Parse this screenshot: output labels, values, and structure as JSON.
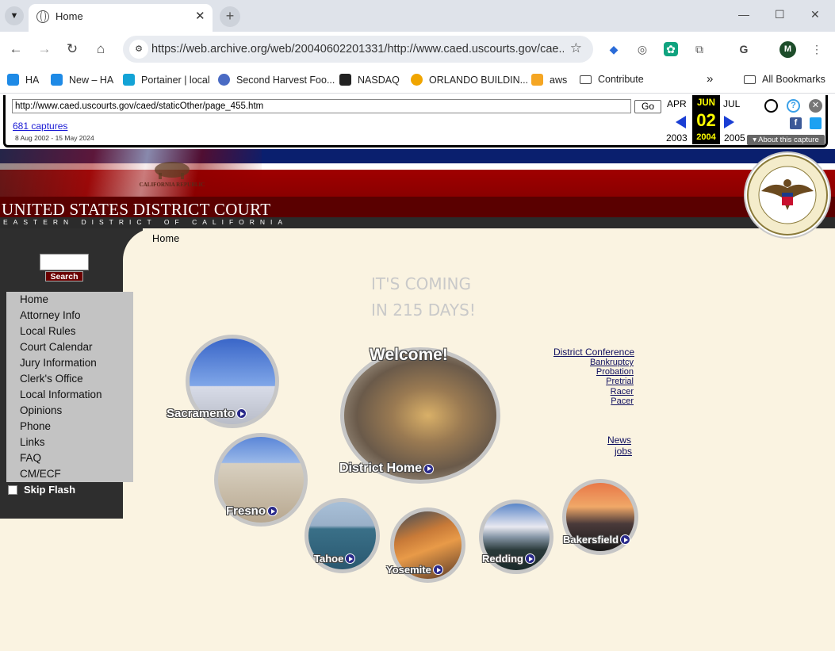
{
  "browser": {
    "tab_title": "Home",
    "url": "https://web.archive.org/web/20040602201331/http://www.caed.uscourts.gov/cae...",
    "bookmarks": [
      {
        "label": "HA",
        "color": "#1e8ae6"
      },
      {
        "label": "New – HA",
        "color": "#1e8ae6"
      },
      {
        "label": "Portainer | local",
        "color": "#13a3d6"
      },
      {
        "label": "Second Harvest Foo...",
        "color": "#4a6bc4"
      },
      {
        "label": "NASDAQ",
        "color": "#222222"
      },
      {
        "label": "ORLANDO BUILDIN...",
        "color": "#f0a500"
      },
      {
        "label": "aws",
        "color": "#f5a623"
      },
      {
        "label": "Contribute",
        "color": "folder"
      }
    ],
    "all_bookmarks": "All Bookmarks",
    "overflow": "»",
    "profile_initial": "M"
  },
  "wayback": {
    "url": "http://www.caed.uscourts.gov/caed/staticOther/page_455.htm",
    "go": "Go",
    "captures": "681 captures",
    "range": "8 Aug 2002 - 15 May 2024",
    "prev_month": "APR",
    "cur_month": "JUN",
    "next_month": "JUL",
    "cur_day": "02",
    "prev_year": "2003",
    "cur_year": "2004",
    "next_year": "2005",
    "about": "▾ About this capture"
  },
  "court": {
    "title": "UNITED STATES DISTRICT COURT",
    "subtitle": "EASTERN DISTRICT OF CALIFORNIA",
    "flag_text": "CALIFORNIA REPUBLIC",
    "seal_text": "UNITED STATES DISTRICT COURT · Eastern District of California"
  },
  "page": {
    "breadcrumb": "Home",
    "search_button": "Search",
    "nav": [
      "Home",
      "Attorney Info",
      "Local Rules",
      "Court Calendar",
      "Jury Information",
      "Clerk's Office",
      "Local Information",
      "Opinions",
      "Phone",
      "Links",
      "FAQ",
      "CM/ECF"
    ],
    "skip_flash": "Skip Flash",
    "countdown_line1": "IT'S COMING",
    "countdown_line2": "IN 215 DAYS!",
    "welcome": "Welcome!",
    "circles": {
      "sacramento": "Sacramento",
      "district_home": "District Home",
      "fresno": "Fresno",
      "tahoe": "Tahoe",
      "yosemite": "Yosemite",
      "redding": "Redding",
      "bakersfield": "Bakersfield"
    },
    "right_links": {
      "conference": "District Conference",
      "bankruptcy": "Bankruptcy",
      "probation": "Probation",
      "pretrial": "Pretrial",
      "racer": "Racer",
      "pacer": "Pacer",
      "news": "News",
      "jobs": "jobs"
    }
  }
}
